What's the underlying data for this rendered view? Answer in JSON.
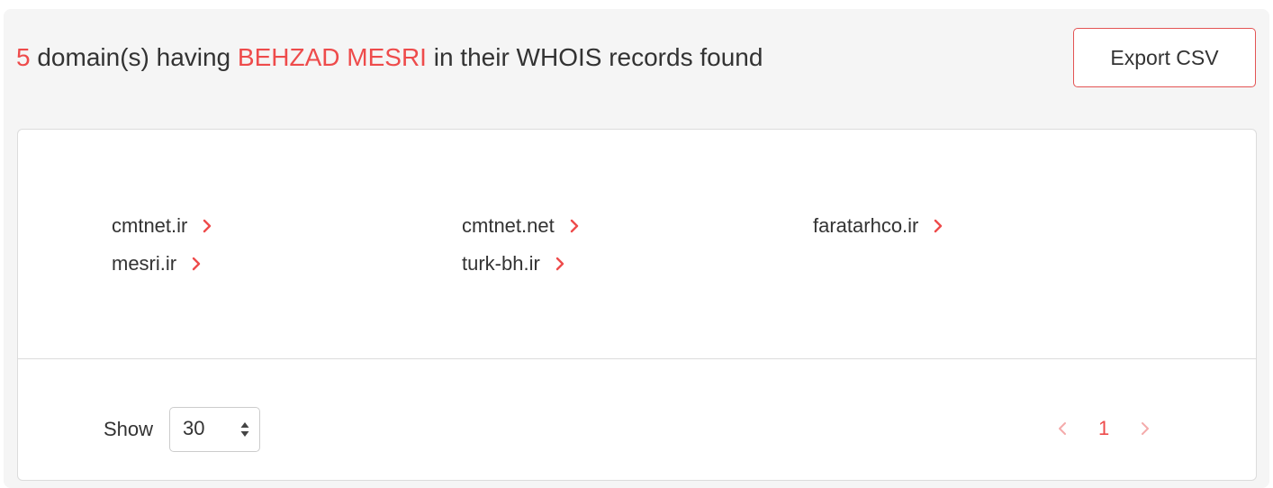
{
  "header": {
    "count": "5",
    "prefix_text": " domain(s) having ",
    "query": "BEHZAD MESRI",
    "suffix_text": " in their WHOIS records found"
  },
  "export_button": {
    "label": "Export CSV"
  },
  "domains": [
    {
      "name": "cmtnet.ir"
    },
    {
      "name": "cmtnet.net"
    },
    {
      "name": "faratarhco.ir"
    },
    {
      "name": "mesri.ir"
    },
    {
      "name": "turk-bh.ir"
    }
  ],
  "pagination": {
    "show_label": "Show",
    "page_size": "30",
    "current_page": "1"
  },
  "colors": {
    "accent": "#ee4b4b",
    "text": "#333333",
    "panel_border": "#dcdcdc",
    "background": "#f5f5f5"
  },
  "icons": {
    "domain_link": "chevron-right-icon",
    "select": "sort-arrows-icon",
    "pager_prev": "chevron-left-icon",
    "pager_next": "chevron-right-icon"
  }
}
